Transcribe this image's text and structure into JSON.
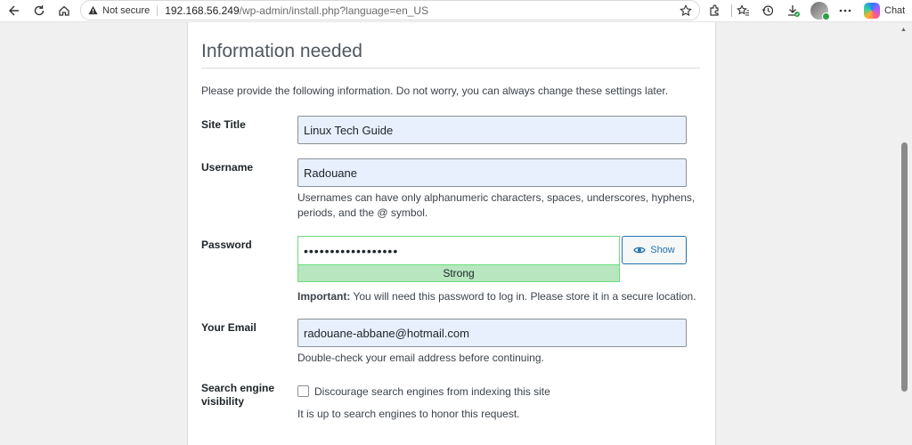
{
  "browser": {
    "security_label": "Not secure",
    "url_host": "192.168.56.249",
    "url_path": "/wp-admin/install.php?language=en_US",
    "chat_label": "Chat"
  },
  "page": {
    "heading": "Information needed",
    "intro": "Please provide the following information. Do not worry, you can always change these settings later."
  },
  "form": {
    "site_title": {
      "label": "Site Title",
      "value": "Linux Tech Guide"
    },
    "username": {
      "label": "Username",
      "value": "Radouane",
      "hint_line1": "Usernames can have only alphanumeric characters, spaces, underscores, hyphens,",
      "hint_line2": "periods, and the @ symbol."
    },
    "password": {
      "label": "Password",
      "value": "••••••••••••••••••",
      "strength": "Strong",
      "show_label": "Show",
      "important_prefix": "Important:",
      "important_text": " You will need this password to log in. Please store it in a secure location."
    },
    "email": {
      "label": "Your Email",
      "value": "radouane-abbane@hotmail.com",
      "hint": "Double-check your email address before continuing."
    },
    "search_visibility": {
      "label_line1": "Search engine",
      "label_line2": "visibility",
      "checkbox_label": "Discourage search engines from indexing this site",
      "checked": false,
      "hint": "It is up to search engines to honor this request."
    }
  },
  "colors": {
    "accent": "#2271b1",
    "strength_bg": "#b8e6bf",
    "strength_border": "#68de7c",
    "autofill_bg": "#e8f0fe"
  }
}
